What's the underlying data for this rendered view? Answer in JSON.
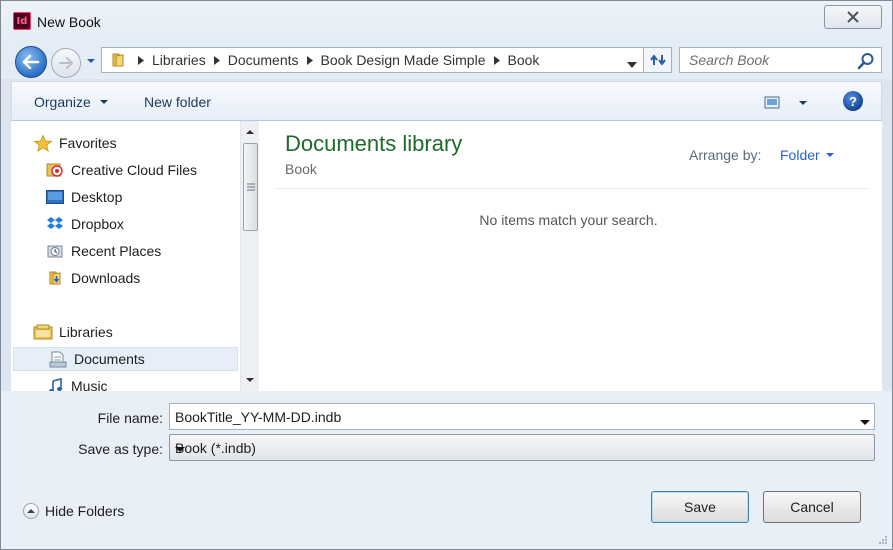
{
  "window": {
    "title": "New Book",
    "app_icon_text": "Id"
  },
  "address": {
    "crumbs": [
      "Libraries",
      "Documents",
      "Book Design Made Simple",
      "Book"
    ]
  },
  "search": {
    "placeholder": "Search Book"
  },
  "toolbar": {
    "organize_label": "Organize",
    "new_folder_label": "New folder",
    "help_label": "?"
  },
  "nav": {
    "favorites_label": "Favorites",
    "favorites": [
      "Creative Cloud Files",
      "Desktop",
      "Dropbox",
      "Recent Places",
      "Downloads"
    ],
    "libraries_label": "Libraries",
    "libraries": [
      "Documents",
      "Music"
    ],
    "selected": "Documents"
  },
  "content": {
    "title": "Documents library",
    "subtitle": "Book",
    "arrange_label": "Arrange by:",
    "arrange_value": "Folder",
    "empty_message": "No items match your search."
  },
  "form": {
    "file_name_label": "File name:",
    "file_name_value": "BookTitle_YY-MM-DD.indb",
    "save_type_label": "Save as type:",
    "save_type_value": "Book (*.indb)",
    "hide_folders_label": "Hide Folders",
    "save_label": "Save",
    "cancel_label": "Cancel"
  },
  "colors": {
    "library_title": "#1e6a2a",
    "link_blue": "#2a64c5",
    "window_bg": "#dde6f0"
  }
}
